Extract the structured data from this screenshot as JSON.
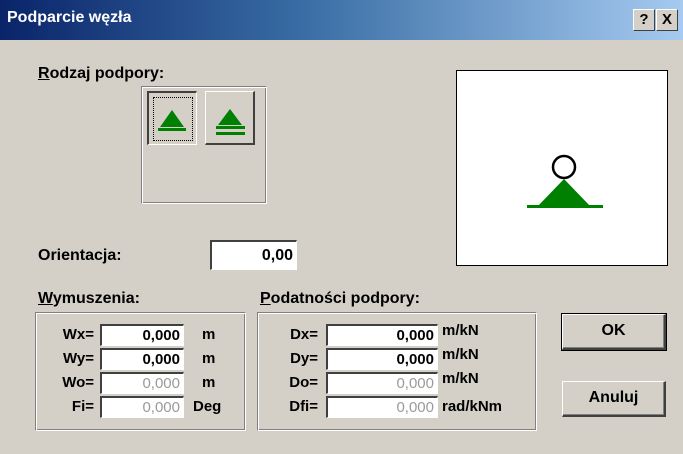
{
  "window": {
    "title": "Podparcie węzła",
    "help_label": "?",
    "close_label": "X"
  },
  "support_type": {
    "label_underlined": "R",
    "label_rest": "odzaj podpory:",
    "selected": 0
  },
  "orientation": {
    "label": "Orientacja:",
    "value": "0,00"
  },
  "displacements": {
    "label_underlined": "W",
    "label_rest": "ymuszenia:",
    "rows": [
      {
        "label": "Wx=",
        "value": "0,000",
        "unit": "m",
        "enabled": true
      },
      {
        "label": "Wy=",
        "value": "0,000",
        "unit": "m",
        "enabled": true
      },
      {
        "label": "Wo=",
        "value": "0,000",
        "unit": "m",
        "enabled": false
      },
      {
        "label": "Fi=",
        "value": "0,000",
        "unit": "Deg",
        "enabled": false
      }
    ]
  },
  "compliance": {
    "label_underlined": "P",
    "label_rest": "odatności podpory:",
    "rows": [
      {
        "label": "Dx=",
        "value": "0,000",
        "unit": "m/kN",
        "enabled": true
      },
      {
        "label": "Dy=",
        "value": "0,000",
        "unit": "m/kN",
        "enabled": true
      },
      {
        "label": "Do=",
        "value": "0,000",
        "unit": "m/kN",
        "enabled": false
      },
      {
        "label": "Dfi=",
        "value": "0,000",
        "unit": "rad/kNm",
        "enabled": false
      }
    ]
  },
  "buttons": {
    "ok": "OK",
    "cancel": "Anuluj"
  },
  "colors": {
    "support_green": "#008000",
    "disabled_text": "#9a9a9a"
  }
}
